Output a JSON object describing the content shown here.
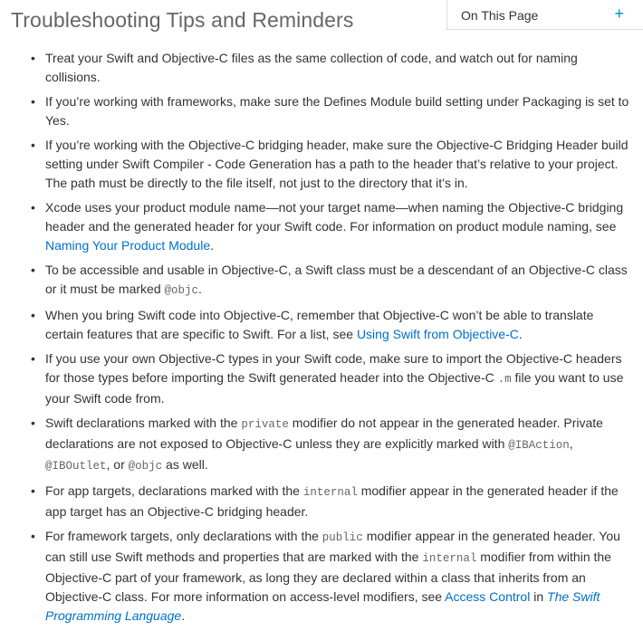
{
  "title": "Troubleshooting Tips and Reminders",
  "on_this_page": {
    "label": "On This Page",
    "toggle": "+"
  },
  "tips": [
    {
      "text": "Treat your Swift and Objective-C files as the same collection of code, and watch out for naming collisions."
    },
    {
      "text": "If you’re working with frameworks, make sure the Defines Module build setting under Packaging is set to Yes."
    },
    {
      "text": "If you’re working with the Objective-C bridging header, make sure the Objective-C Bridging Header build setting under Swift Compiler - Code Generation has a path to the header that’s relative to your project. The path must be directly to the file itself, not just to the directory that it’s in."
    },
    {
      "pre": "Xcode uses your product module name—not your target name—when naming the Objective-C bridging header and the generated header for your Swift code. For information on product module naming, see ",
      "link": "Naming Your Product Module",
      "post": "."
    },
    {
      "pre": "To be accessible and usable in Objective-C, a Swift class must be a descendant of an Objective-C class or it must be marked ",
      "code": "@objc",
      "post": "."
    },
    {
      "pre": "When you bring Swift code into Objective-C, remember that Objective-C won’t be able to translate certain features that are specific to Swift. For a list, see ",
      "link": "Using Swift from Objective-C",
      "post": "."
    },
    {
      "pre": "If you use your own Objective-C types in your Swift code, make sure to import the Objective-C headers for those types before importing the Swift generated header into the Objective-C ",
      "code": ".m",
      "post": " file you want to use your Swift code from."
    },
    {
      "pre": "Swift declarations marked with the ",
      "code1": "private",
      "mid1": " modifier do not appear in the generated header. Private declarations are not exposed to Objective-C unless they are explicitly marked with ",
      "code2": "@IBAction",
      "mid2": ", ",
      "code3": "@IBOutlet",
      "mid3": ", or ",
      "code4": "@objc",
      "post": " as well."
    },
    {
      "pre": "For app targets, declarations marked with the ",
      "code": "internal",
      "post": " modifier appear in the generated header if the app target has an Objective-C bridging header."
    },
    {
      "pre": "For framework targets, only declarations with the ",
      "code1": "public",
      "mid1": " modifier appear in the generated header. You can still use Swift methods and properties that are marked with the ",
      "code2": "internal",
      "mid2": " modifier from within the Objective-C part of your framework, as long they are declared within a class that inherits from an Objective-C class. For more information on access-level modifiers, see ",
      "link": "Access Control",
      "mid3": " in ",
      "link2": "The Swift Programming Language",
      "post": "."
    }
  ]
}
